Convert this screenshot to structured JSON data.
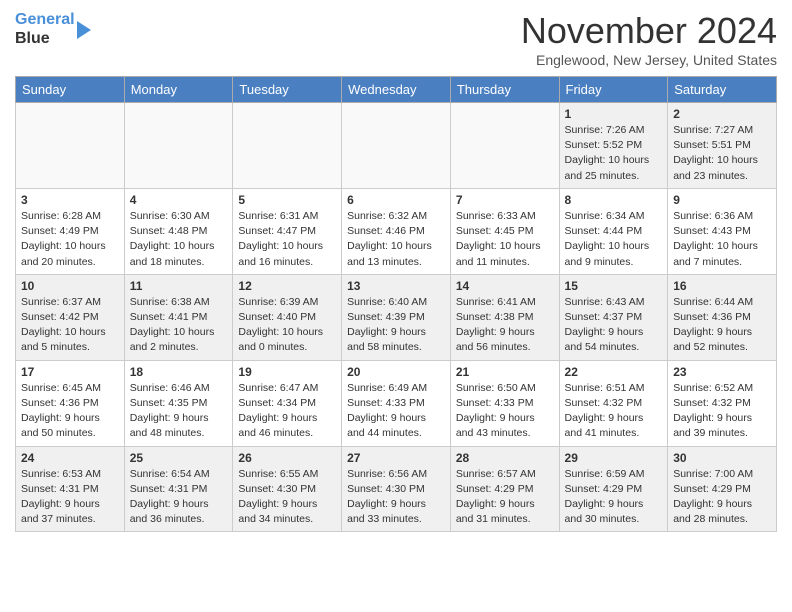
{
  "header": {
    "logo_line1": "General",
    "logo_line2": "Blue",
    "title": "November 2024",
    "location": "Englewood, New Jersey, United States"
  },
  "weekdays": [
    "Sunday",
    "Monday",
    "Tuesday",
    "Wednesday",
    "Thursday",
    "Friday",
    "Saturday"
  ],
  "weeks": [
    [
      {
        "day": "",
        "info": "",
        "empty": true
      },
      {
        "day": "",
        "info": "",
        "empty": true
      },
      {
        "day": "",
        "info": "",
        "empty": true
      },
      {
        "day": "",
        "info": "",
        "empty": true
      },
      {
        "day": "",
        "info": "",
        "empty": true
      },
      {
        "day": "1",
        "info": "Sunrise: 7:26 AM\nSunset: 5:52 PM\nDaylight: 10 hours and 25 minutes."
      },
      {
        "day": "2",
        "info": "Sunrise: 7:27 AM\nSunset: 5:51 PM\nDaylight: 10 hours and 23 minutes."
      }
    ],
    [
      {
        "day": "3",
        "info": "Sunrise: 6:28 AM\nSunset: 4:49 PM\nDaylight: 10 hours and 20 minutes."
      },
      {
        "day": "4",
        "info": "Sunrise: 6:30 AM\nSunset: 4:48 PM\nDaylight: 10 hours and 18 minutes."
      },
      {
        "day": "5",
        "info": "Sunrise: 6:31 AM\nSunset: 4:47 PM\nDaylight: 10 hours and 16 minutes."
      },
      {
        "day": "6",
        "info": "Sunrise: 6:32 AM\nSunset: 4:46 PM\nDaylight: 10 hours and 13 minutes."
      },
      {
        "day": "7",
        "info": "Sunrise: 6:33 AM\nSunset: 4:45 PM\nDaylight: 10 hours and 11 minutes."
      },
      {
        "day": "8",
        "info": "Sunrise: 6:34 AM\nSunset: 4:44 PM\nDaylight: 10 hours and 9 minutes."
      },
      {
        "day": "9",
        "info": "Sunrise: 6:36 AM\nSunset: 4:43 PM\nDaylight: 10 hours and 7 minutes."
      }
    ],
    [
      {
        "day": "10",
        "info": "Sunrise: 6:37 AM\nSunset: 4:42 PM\nDaylight: 10 hours and 5 minutes."
      },
      {
        "day": "11",
        "info": "Sunrise: 6:38 AM\nSunset: 4:41 PM\nDaylight: 10 hours and 2 minutes."
      },
      {
        "day": "12",
        "info": "Sunrise: 6:39 AM\nSunset: 4:40 PM\nDaylight: 10 hours and 0 minutes."
      },
      {
        "day": "13",
        "info": "Sunrise: 6:40 AM\nSunset: 4:39 PM\nDaylight: 9 hours and 58 minutes."
      },
      {
        "day": "14",
        "info": "Sunrise: 6:41 AM\nSunset: 4:38 PM\nDaylight: 9 hours and 56 minutes."
      },
      {
        "day": "15",
        "info": "Sunrise: 6:43 AM\nSunset: 4:37 PM\nDaylight: 9 hours and 54 minutes."
      },
      {
        "day": "16",
        "info": "Sunrise: 6:44 AM\nSunset: 4:36 PM\nDaylight: 9 hours and 52 minutes."
      }
    ],
    [
      {
        "day": "17",
        "info": "Sunrise: 6:45 AM\nSunset: 4:36 PM\nDaylight: 9 hours and 50 minutes."
      },
      {
        "day": "18",
        "info": "Sunrise: 6:46 AM\nSunset: 4:35 PM\nDaylight: 9 hours and 48 minutes."
      },
      {
        "day": "19",
        "info": "Sunrise: 6:47 AM\nSunset: 4:34 PM\nDaylight: 9 hours and 46 minutes."
      },
      {
        "day": "20",
        "info": "Sunrise: 6:49 AM\nSunset: 4:33 PM\nDaylight: 9 hours and 44 minutes."
      },
      {
        "day": "21",
        "info": "Sunrise: 6:50 AM\nSunset: 4:33 PM\nDaylight: 9 hours and 43 minutes."
      },
      {
        "day": "22",
        "info": "Sunrise: 6:51 AM\nSunset: 4:32 PM\nDaylight: 9 hours and 41 minutes."
      },
      {
        "day": "23",
        "info": "Sunrise: 6:52 AM\nSunset: 4:32 PM\nDaylight: 9 hours and 39 minutes."
      }
    ],
    [
      {
        "day": "24",
        "info": "Sunrise: 6:53 AM\nSunset: 4:31 PM\nDaylight: 9 hours and 37 minutes."
      },
      {
        "day": "25",
        "info": "Sunrise: 6:54 AM\nSunset: 4:31 PM\nDaylight: 9 hours and 36 minutes."
      },
      {
        "day": "26",
        "info": "Sunrise: 6:55 AM\nSunset: 4:30 PM\nDaylight: 9 hours and 34 minutes."
      },
      {
        "day": "27",
        "info": "Sunrise: 6:56 AM\nSunset: 4:30 PM\nDaylight: 9 hours and 33 minutes."
      },
      {
        "day": "28",
        "info": "Sunrise: 6:57 AM\nSunset: 4:29 PM\nDaylight: 9 hours and 31 minutes."
      },
      {
        "day": "29",
        "info": "Sunrise: 6:59 AM\nSunset: 4:29 PM\nDaylight: 9 hours and 30 minutes."
      },
      {
        "day": "30",
        "info": "Sunrise: 7:00 AM\nSunset: 4:29 PM\nDaylight: 9 hours and 28 minutes."
      }
    ]
  ]
}
